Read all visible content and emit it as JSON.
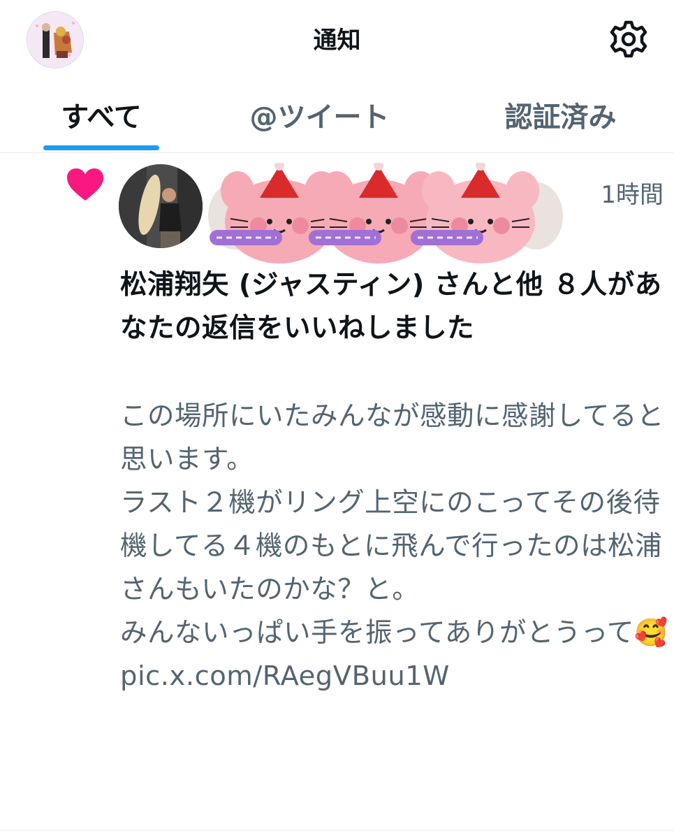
{
  "header": {
    "title": "通知",
    "profile_icon": "profile-avatar",
    "settings_icon": "gear-icon"
  },
  "tabs": [
    {
      "label": "すべて",
      "active": true
    },
    {
      "label": "@ツイート",
      "active": false
    },
    {
      "label": "認証済み",
      "active": false
    }
  ],
  "notification": {
    "type_icon": "heart-icon",
    "timestamp": "1時間",
    "headline": {
      "actor": "松浦翔矢 (ジャスティン)",
      "rest": " さんと他 ８人があなたの返信をいいねしました"
    },
    "tweet_text": "この場所にいたみんなが感動に感謝してると思います。\nラスト２機がリング上空にのこってその後待機してる４機のもとに飛んで行ったのは松浦さんもいたのかな？と。\nみんないっぱい手を振ってありがとうって🥰 pic.x.com/RAegVBuu1W"
  },
  "colors": {
    "accent": "#1d9bf0",
    "like": "#f91880",
    "secondary_text": "#536471",
    "primary_text": "#0f1419"
  }
}
